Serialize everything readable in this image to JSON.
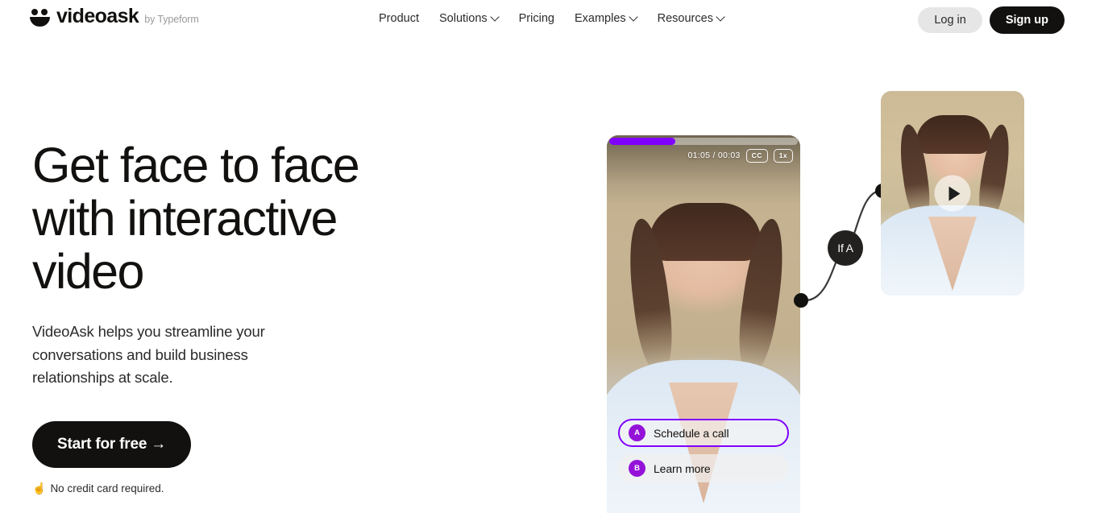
{
  "brand": {
    "logo_icon": "smiley-face-icon",
    "name": "videoask",
    "byline": "by Typeform"
  },
  "nav": {
    "items": [
      {
        "label": "Product",
        "has_dropdown": false
      },
      {
        "label": "Solutions",
        "has_dropdown": true
      },
      {
        "label": "Pricing",
        "has_dropdown": false
      },
      {
        "label": "Examples",
        "has_dropdown": true
      },
      {
        "label": "Resources",
        "has_dropdown": true
      }
    ]
  },
  "auth": {
    "login_label": "Log in",
    "signup_label": "Sign up"
  },
  "hero": {
    "headline": "Get face to face\nwith interactive\nvideo",
    "subhead": "VideoAsk helps you streamline your\nconversations and build business\nrelationships at scale.",
    "cta_label": "Start for free →",
    "note_emoji": "☝️",
    "note_text": "No credit card required."
  },
  "mock": {
    "player": {
      "progress_percent": 35,
      "timecode": "01:05 / 00:03",
      "cc_label": "CC",
      "speed_label": "1x"
    },
    "answers": [
      {
        "key": "A",
        "label": "Schedule a call",
        "selected": true
      },
      {
        "key": "B",
        "label": "Learn more",
        "selected": false
      }
    ],
    "logic": {
      "condition_label": "If A"
    },
    "second_card": {
      "play_icon": "play-icon"
    }
  },
  "colors": {
    "accent_purple": "#8000ff",
    "badge_purple": "#9412d8",
    "ink": "#12110f",
    "login_bg": "#e6e6e6",
    "background": "#ffffff"
  }
}
